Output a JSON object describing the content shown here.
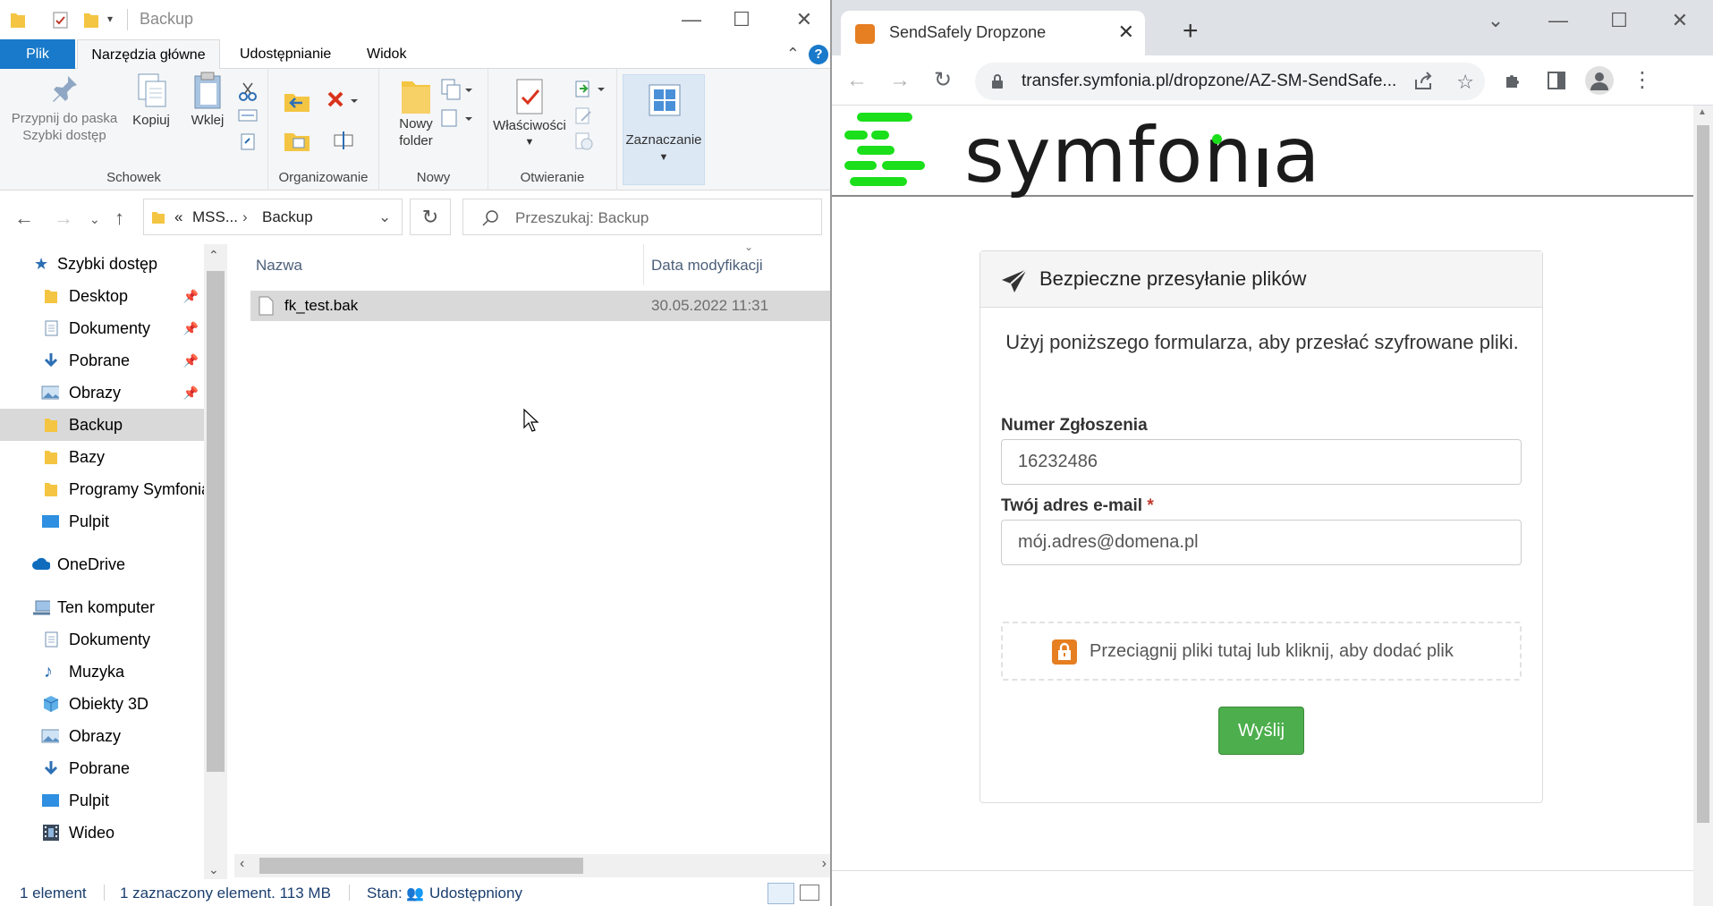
{
  "explorer": {
    "title": "Backup",
    "tabs": {
      "file": "Plik",
      "home": "Narzędzia główne",
      "share": "Udostępnianie",
      "view": "Widok"
    },
    "ribbon": {
      "pin": "Przypnij do paska Szybki dostęp",
      "copy": "Kopiuj",
      "paste": "Wklej",
      "group_clipboard": "Schowek",
      "group_organize": "Organizowanie",
      "new_folder": "Nowy folder",
      "group_new": "Nowy",
      "properties": "Właściwości",
      "group_open": "Otwieranie",
      "select": "Zaznaczanie"
    },
    "address": {
      "ellipsis": "«",
      "parent": "MSS...",
      "current": "Backup"
    },
    "search_placeholder": "Przeszukaj: Backup",
    "nav": [
      {
        "label": "Szybki dostęp",
        "icon": "star-icon"
      },
      {
        "label": "Desktop",
        "icon": "folder-icon",
        "pinned": true
      },
      {
        "label": "Dokumenty",
        "icon": "documents-icon",
        "pinned": true
      },
      {
        "label": "Pobrane",
        "icon": "download-icon",
        "pinned": true
      },
      {
        "label": "Obrazy",
        "icon": "pictures-icon",
        "pinned": true
      },
      {
        "label": "Backup",
        "icon": "folder-icon",
        "selected": true
      },
      {
        "label": "Bazy",
        "icon": "folder-icon"
      },
      {
        "label": "Programy Symfonia",
        "icon": "folder-icon"
      },
      {
        "label": "Pulpit",
        "icon": "desktop-icon"
      },
      {
        "label": "OneDrive",
        "icon": "cloud-icon"
      },
      {
        "label": "Ten komputer",
        "icon": "computer-icon"
      },
      {
        "label": "Dokumenty",
        "icon": "documents-icon"
      },
      {
        "label": "Muzyka",
        "icon": "music-icon"
      },
      {
        "label": "Obiekty 3D",
        "icon": "cube-icon"
      },
      {
        "label": "Obrazy",
        "icon": "pictures-icon"
      },
      {
        "label": "Pobrane",
        "icon": "download-icon"
      },
      {
        "label": "Pulpit",
        "icon": "desktop-icon"
      },
      {
        "label": "Wideo",
        "icon": "video-icon"
      }
    ],
    "columns": {
      "name": "Nazwa",
      "modified": "Data modyfikacji"
    },
    "files": [
      {
        "name": "fk_test.bak",
        "modified": "30.05.2022 11:31"
      }
    ],
    "status": {
      "count": "1 element",
      "selected": "1 zaznaczony element. 113 MB",
      "state": "Stan:",
      "shared": "Udostępniony"
    }
  },
  "browser": {
    "tab_title": "SendSafely Dropzone",
    "url": "transfer.symfonia.pl/dropzone/AZ-SM-SendSafe...",
    "logo_text": "symfon",
    "logo_tail": "a",
    "form": {
      "heading": "Bezpieczne przesyłanie plików",
      "intro": "Użyj poniższego formularza, aby przesłać szyfrowane pliki.",
      "ticket_label": "Numer Zgłoszenia",
      "ticket_value": "16232486",
      "email_label": "Twój adres e-mail",
      "email_required": "*",
      "email_value": "mój.adres@domena.pl",
      "dropzone_text": "Przeciągnij pliki tutaj lub kliknij, aby dodać plik",
      "submit": "Wyślij"
    },
    "colors": {
      "brand_green": "#1adf1a",
      "submit_green": "#4cae4c",
      "lock_orange": "#e67e22"
    }
  }
}
